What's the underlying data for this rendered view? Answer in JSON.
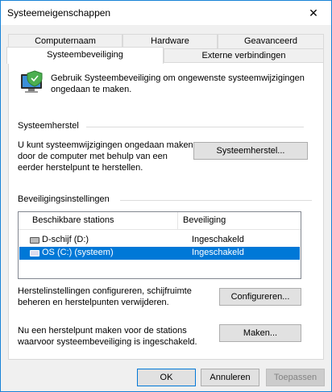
{
  "window": {
    "title": "Systeemeigenschappen",
    "close_glyph": "✕"
  },
  "tabs_row1": [
    {
      "label": "Computernaam"
    },
    {
      "label": "Hardware"
    },
    {
      "label": "Geavanceerd"
    }
  ],
  "tabs_row2": [
    {
      "label": "Systeembeveiliging",
      "active": true
    },
    {
      "label": "Externe verbindingen"
    }
  ],
  "intro": {
    "icon": "system-protection-icon",
    "text": "Gebruik Systeembeveiliging om ongewenste systeemwijzigingen ongedaan te maken."
  },
  "restore": {
    "heading": "Systeemherstel",
    "description": "U kunt systeemwijzigingen ongedaan maken door de computer met behulp van een eerder herstelpunt te herstellen.",
    "button": "Systeemherstel..."
  },
  "protection": {
    "heading": "Beveiligingsinstellingen",
    "columns": [
      "Beschikbare stations",
      "Beveiliging"
    ],
    "rows": [
      {
        "name": "D-schijf (D:)",
        "status": "Ingeschakeld",
        "selected": false,
        "icon": "drive-icon"
      },
      {
        "name": "OS (C:) (systeem)",
        "status": "Ingeschakeld",
        "selected": true,
        "icon": "system-drive-icon"
      }
    ],
    "configure_text": "Herstelinstellingen configureren, schijfruimte beheren en herstelpunten verwijderen.",
    "configure_button": "Configureren...",
    "create_text": "Nu een herstelpunt maken voor de stations waarvoor systeembeveiliging is ingeschakeld.",
    "create_button": "Maken..."
  },
  "footer": {
    "ok": "OK",
    "cancel": "Annuleren",
    "apply": "Toepassen"
  }
}
